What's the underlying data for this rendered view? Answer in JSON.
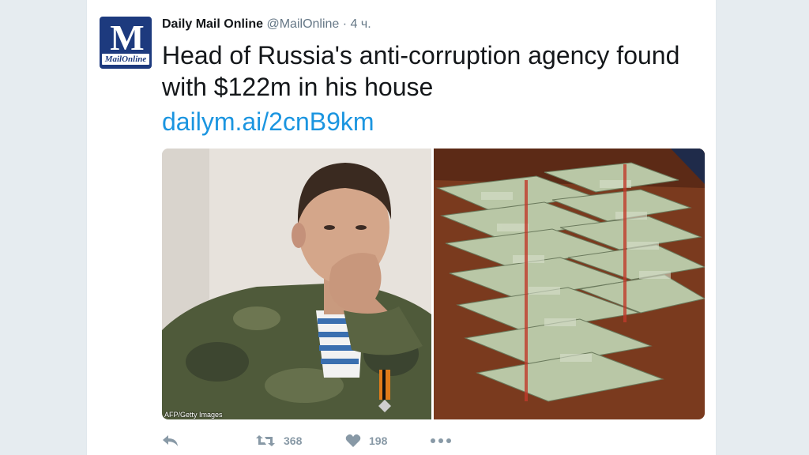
{
  "tweet": {
    "author_name": "Daily Mail Online",
    "handle": "@MailOnline",
    "separator": "·",
    "time": "4 ч.",
    "text": "Head of Russia's anti-corruption agency found with $122m in his house",
    "link": "dailym.ai/2cnB9km",
    "avatar": {
      "monogram": "M",
      "wordmark": "MailOnline",
      "color": "#1d3a7e"
    },
    "media": {
      "left_subject": "man in camouflage uniform",
      "right_subject": "stacks of $100 bills on table",
      "credit": "AFP/Getty Images"
    },
    "actions": {
      "reply_icon": "reply-icon",
      "retweet_icon": "retweet-icon",
      "retweet_count": "368",
      "like_icon": "heart-icon",
      "like_count": "198",
      "more_icon": "more-dots-icon"
    }
  },
  "colors": {
    "link": "#1b95e0",
    "text": "#14171a",
    "meta": "#657786",
    "action": "#8899a6",
    "background": "#e6ecf0"
  }
}
